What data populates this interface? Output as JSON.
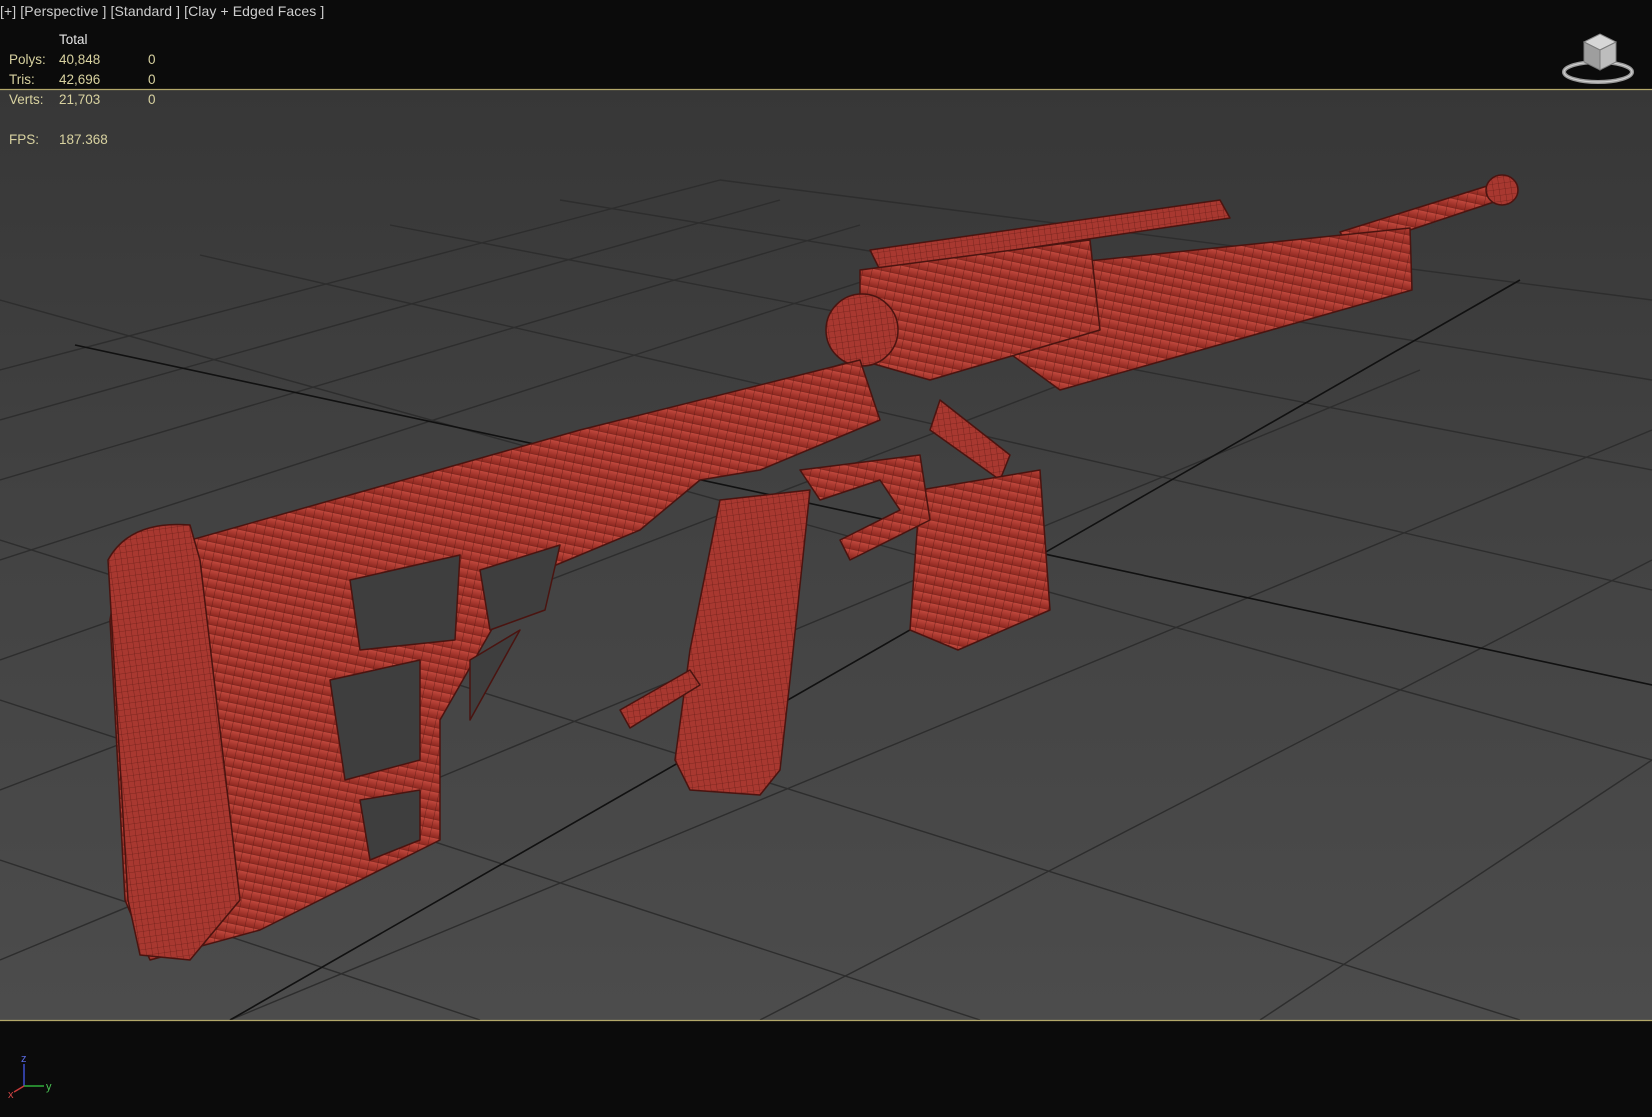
{
  "viewport": {
    "label_plus": "[+]",
    "label_view": "[Perspective ]",
    "label_shading_1": "[Standard ]",
    "label_shading_2": "[Clay + Edged Faces ]"
  },
  "stats": {
    "header": "Total",
    "rows": [
      {
        "key": "Polys:",
        "value": "40,848",
        "selected": "0"
      },
      {
        "key": "Tris:",
        "value": "42,696",
        "selected": "0"
      },
      {
        "key": "Verts:",
        "value": "21,703",
        "selected": "0"
      }
    ],
    "fps_key": "FPS:",
    "fps_value": "187.368"
  },
  "axis": {
    "x": "x",
    "y": "y",
    "z": "z"
  },
  "colors": {
    "model": "#b13a30",
    "model_dark": "#6d1f19",
    "safe_frame": "#b3a86a",
    "ground": "#444444",
    "grid": "#2b2b2b"
  }
}
